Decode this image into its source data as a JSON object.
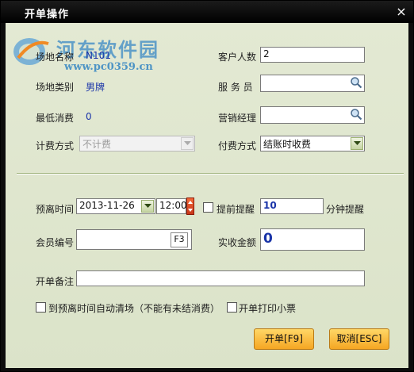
{
  "window": {
    "title": "开单操作",
    "close_glyph": "×"
  },
  "watermark": {
    "title": "河东软件园",
    "url": "www.pc0359.cn"
  },
  "form": {
    "venue_name_label": "场地名称",
    "venue_name_value": "N101",
    "venue_type_label": "场地类别",
    "venue_type_value": "男牌",
    "min_spend_label": "最低消费",
    "min_spend_value": "0",
    "billing_mode_label": "计费方式",
    "billing_mode_value": "不计费",
    "guest_count_label": "客户人数",
    "guest_count_value": "2",
    "waiter_label": "服 务 员",
    "waiter_value": "",
    "sales_manager_label": "营销经理",
    "sales_manager_value": "",
    "payment_mode_label": "付费方式",
    "payment_mode_value": "结账时收费",
    "leave_time_label": "预离时间",
    "leave_date_value": "2013-11-26",
    "leave_time_value": "12:00",
    "remind_label": "提前提醒",
    "remind_minutes_value": "10",
    "remind_unit_label": "分钟提醒",
    "member_no_label": "会员编号",
    "member_no_value": "",
    "member_key_hint": "F3",
    "received_amount_label": "实收金额",
    "received_amount_value": "0",
    "remark_label": "开单备注",
    "remark_value": "",
    "auto_clear_label": "到预离时间自动清场（不能有未结消费）",
    "print_ticket_label": "开单打印小票"
  },
  "buttons": {
    "open_label": "开单[F9]",
    "cancel_label": "取消[ESC]"
  },
  "colors": {
    "title_bg": "#000000",
    "client_bg": "#dfe6cf",
    "value_text": "#1a34a8",
    "button_bg": "#f5a623"
  }
}
